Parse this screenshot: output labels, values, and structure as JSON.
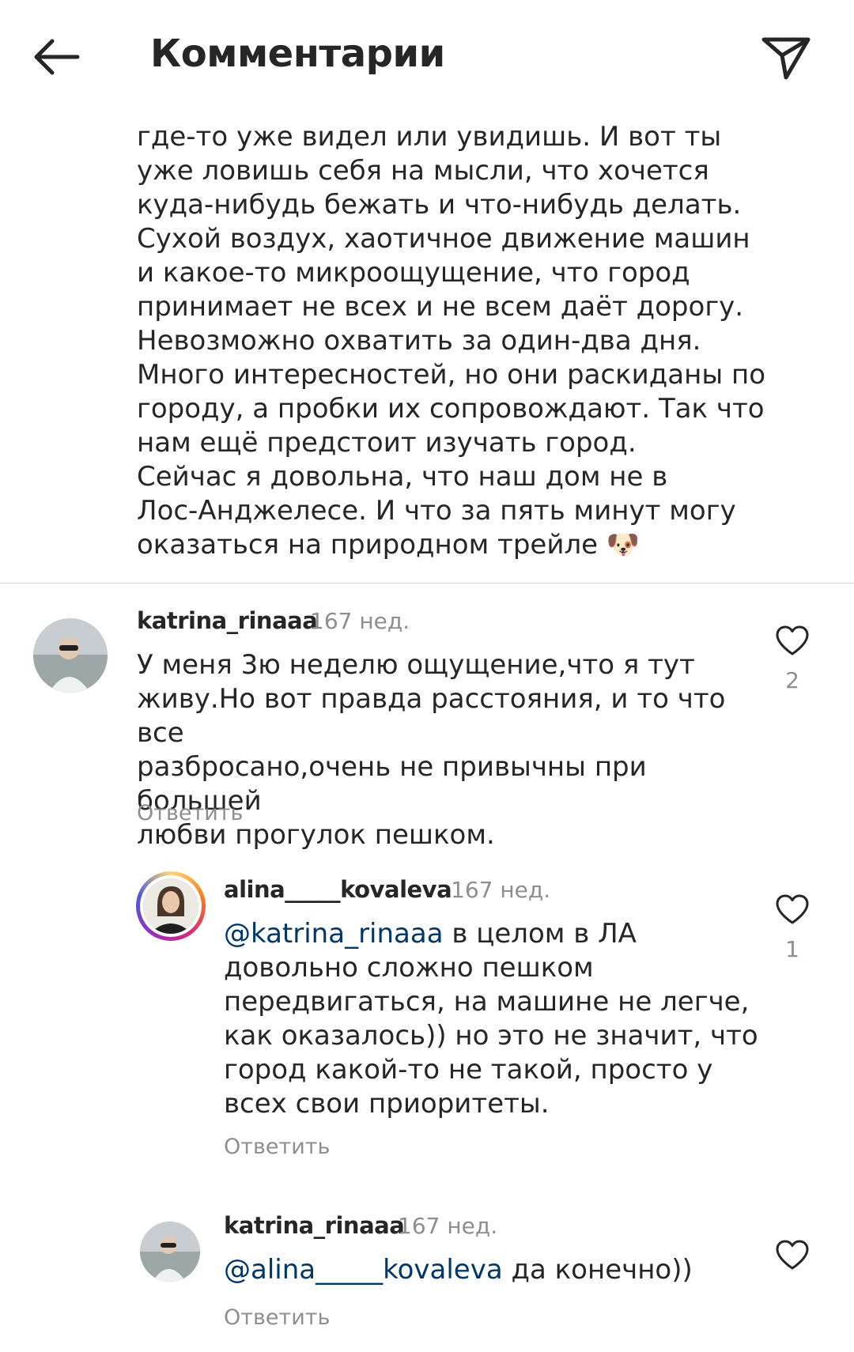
{
  "header": {
    "title": "Комментарии",
    "back_icon": "arrow-left-icon",
    "send_icon": "paper-plane-icon"
  },
  "caption": {
    "cut_line": "..  ..  ..  ..",
    "text": "где-то уже видел или увидишь. И вот ты\nуже ловишь себя на мысли, что хочется\nкуда-нибудь бежать и что-нибудь делать.\nСухой воздух, хаотичное движение машин\nи какое-то микроощущение, что город\nпринимает не всех и не всем даёт дорогу.\nНевозможно охватить за один-два дня.\nМного интересностей, но они раскиданы по\nгороду, а пробки их сопровождают. Так что\nнам ещё предстоит изучать город.\nСейчас я довольна, что наш дом не в\nЛос-Анджелесе. И что за пять минут могу\nоказаться на природном трейле 🐶"
  },
  "comments": [
    {
      "username": "katrina_rinaaa",
      "time": "167 нед.",
      "mention": "",
      "text": "У меня 3ю неделю ощущение,что я тут\nживу.Но вот правда расстояния, и то что все\nразбросано,очень не привычны при большей\nлюбви прогулок пешком.",
      "reply_label": "Ответить",
      "like_count": "2"
    },
    {
      "username": "alina_____kovaleva",
      "time": "167 нед.",
      "mention": "@katrina_rinaaa",
      "text": " в целом в ЛА\nдовольно сложно пешком\nпередвигаться, на машине не легче,\nкак оказалось)) но это не значит, что\nгород какой-то не такой, просто у\nвсех свои приоритеты.",
      "reply_label": "Ответить",
      "like_count": "1"
    },
    {
      "username": "katrina_rinaaa",
      "time": "167 нед.",
      "mention": "@alina_____kovaleva",
      "text": " да конечно))",
      "reply_label": "Ответить",
      "like_count": ""
    }
  ],
  "icons": {
    "like": "heart-outline-icon"
  }
}
